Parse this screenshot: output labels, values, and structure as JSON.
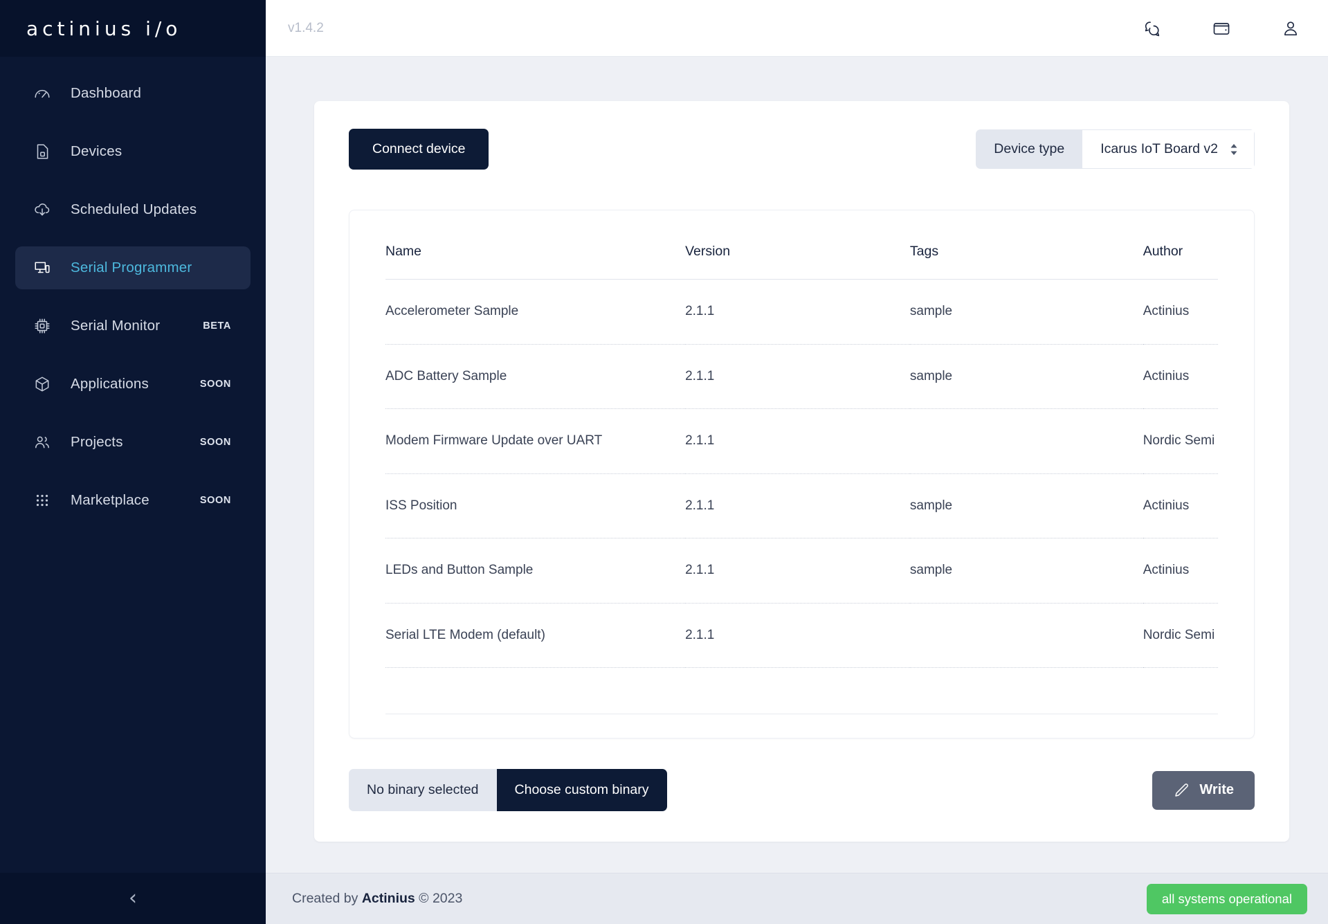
{
  "sidebar": {
    "logo": "actinius i/o",
    "collapse_icon": "chevron-left-icon",
    "items": [
      {
        "label": "Dashboard",
        "icon": "gauge-icon",
        "badge": "",
        "active": false
      },
      {
        "label": "Devices",
        "icon": "sim-card-icon",
        "badge": "",
        "active": false
      },
      {
        "label": "Scheduled Updates",
        "icon": "cloud-download-icon",
        "badge": "",
        "active": false
      },
      {
        "label": "Serial Programmer",
        "icon": "monitor-device-icon",
        "badge": "",
        "active": true
      },
      {
        "label": "Serial Monitor",
        "icon": "cpu-chip-icon",
        "badge": "BETA",
        "active": false
      },
      {
        "label": "Applications",
        "icon": "hexagon-box-icon",
        "badge": "SOON",
        "active": false
      },
      {
        "label": "Projects",
        "icon": "users-icon",
        "badge": "SOON",
        "active": false
      },
      {
        "label": "Marketplace",
        "icon": "grid-dots-icon",
        "badge": "SOON",
        "active": false
      }
    ]
  },
  "topbar": {
    "version": "v1.4.2",
    "icons": [
      "chat-bubbles-icon",
      "wallet-icon",
      "user-icon"
    ]
  },
  "main": {
    "connect_button": "Connect device",
    "device_type_label": "Device type",
    "device_type_value": "Icarus IoT Board v2",
    "table": {
      "headers": [
        "Name",
        "Version",
        "Tags",
        "Author"
      ],
      "rows": [
        {
          "name": "Accelerometer Sample",
          "version": "2.1.1",
          "tags": "sample",
          "author": "Actinius"
        },
        {
          "name": "ADC Battery Sample",
          "version": "2.1.1",
          "tags": "sample",
          "author": "Actinius"
        },
        {
          "name": "Modem Firmware Update over UART",
          "version": "2.1.1",
          "tags": "",
          "author": "Nordic Semi"
        },
        {
          "name": "ISS Position",
          "version": "2.1.1",
          "tags": "sample",
          "author": "Actinius"
        },
        {
          "name": "LEDs and Button Sample",
          "version": "2.1.1",
          "tags": "sample",
          "author": "Actinius"
        },
        {
          "name": "Serial LTE Modem (default)",
          "version": "2.1.1",
          "tags": "",
          "author": "Nordic Semi"
        }
      ]
    },
    "binary_status": "No binary selected",
    "choose_binary_button": "Choose custom binary",
    "write_button": "Write",
    "write_icon": "pencil-icon"
  },
  "footer": {
    "created_prefix": "Created by",
    "company": "Actinius",
    "copyright": "© 2023",
    "status": "all systems operational"
  },
  "colors": {
    "sidebar_bg": "#0b1733",
    "sidebar_dark": "#07122b",
    "active_item_bg": "#1d2a49",
    "accent": "#4db8dd",
    "primary_dark": "#0d1b36",
    "write_gray": "#5b6376",
    "status_green": "#4fc763",
    "page_bg": "#eef0f5"
  }
}
